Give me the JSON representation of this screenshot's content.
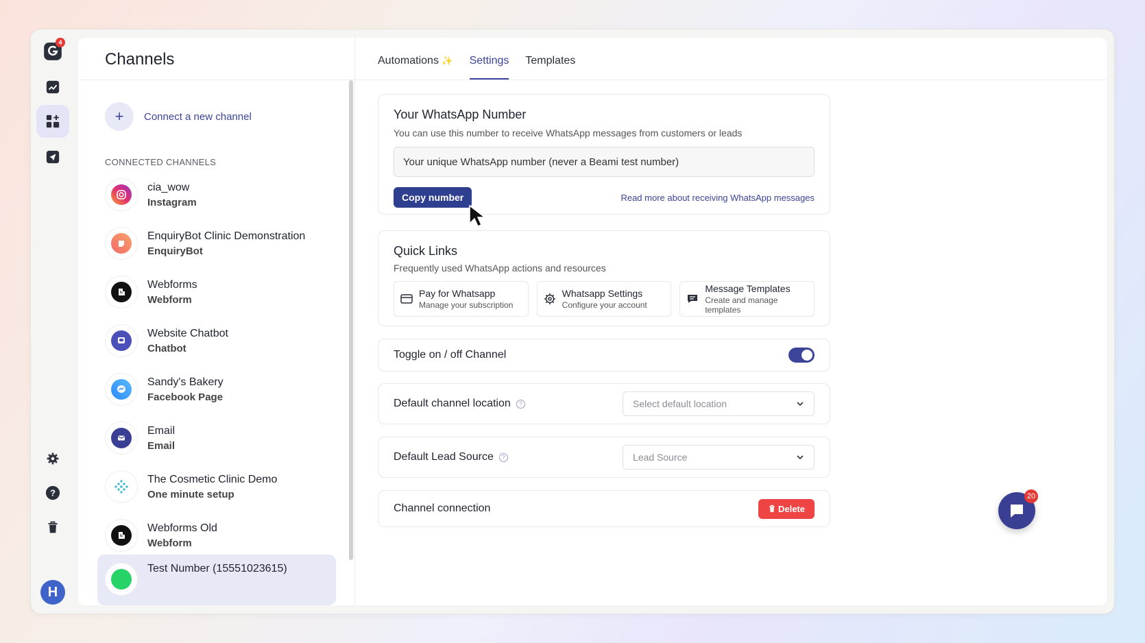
{
  "rail": {
    "logo_badge": "4",
    "avatar_letter": "H"
  },
  "left": {
    "title": "Channels",
    "connect_label": "Connect a new channel",
    "section_label": "CONNECTED CHANNELS",
    "channels": [
      {
        "name": "cia_wow",
        "type": "Instagram",
        "icon": "instagram-icon",
        "color": "#e1306c"
      },
      {
        "name": "EnquiryBot Clinic Demonstration",
        "type": "EnquiryBot",
        "icon": "enquirybot-icon",
        "color": "#f46a6a"
      },
      {
        "name": "Webforms",
        "type": "Webform",
        "icon": "webform-icon",
        "color": "#111111"
      },
      {
        "name": "Website Chatbot",
        "type": "Chatbot",
        "icon": "chatbot-icon",
        "color": "#4b4fb8"
      },
      {
        "name": "Sandy's Bakery",
        "type": "Facebook Page",
        "icon": "messenger-icon",
        "color": "#2d8cff"
      },
      {
        "name": "Email",
        "type": "Email",
        "icon": "email-icon",
        "color": "#3b3f94"
      },
      {
        "name": "The Cosmetic Clinic Demo",
        "type": "One minute setup",
        "icon": "sparkle-grid-icon",
        "color": "#36b6c9"
      },
      {
        "name": "Webforms Old",
        "type": "Webform",
        "icon": "webform-icon",
        "color": "#111111"
      },
      {
        "name": "Test Number (15551023615)",
        "type": "",
        "icon": "whatsapp-icon",
        "color": "#25d366"
      }
    ]
  },
  "tabs": [
    {
      "label": "Automations",
      "sparkle": "✨"
    },
    {
      "label": "Settings"
    },
    {
      "label": "Templates"
    }
  ],
  "whatsapp_card": {
    "title": "Your WhatsApp Number",
    "subtitle": "You can use this number to receive WhatsApp messages from customers or leads",
    "input_value": "Your unique WhatsApp number (never a Beami test number)",
    "copy_label": "Copy number",
    "read_more": "Read more about receiving WhatsApp messages"
  },
  "quick_links": {
    "title": "Quick Links",
    "subtitle": "Frequently used WhatsApp actions and resources",
    "items": [
      {
        "title": "Pay for Whatsapp",
        "sub": "Manage your subscription",
        "icon": "credit-card-icon"
      },
      {
        "title": "Whatsapp Settings",
        "sub": "Configure your account",
        "icon": "gear-icon"
      },
      {
        "title": "Message Templates",
        "sub": "Create and manage templates",
        "icon": "message-icon"
      }
    ]
  },
  "toggle_row": {
    "label": "Toggle on / off Channel",
    "on": true
  },
  "location_row": {
    "label": "Default channel location",
    "placeholder": "Select default location"
  },
  "lead_row": {
    "label": "Default Lead Source",
    "placeholder": "Lead Source"
  },
  "connection_row": {
    "label": "Channel connection",
    "delete_label": "Delete"
  },
  "chat": {
    "badge": "20"
  },
  "colors": {
    "accent": "#3b4499",
    "danger": "#ef4444"
  }
}
